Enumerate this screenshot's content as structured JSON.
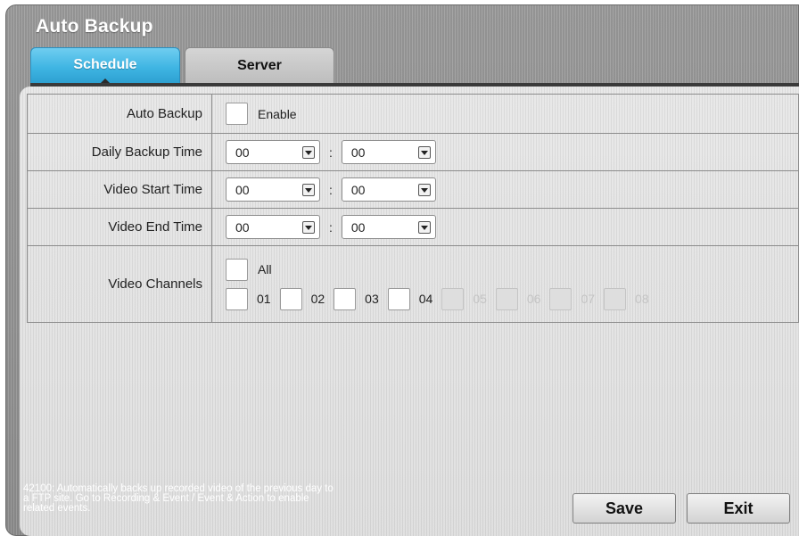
{
  "window": {
    "title": "Auto Backup"
  },
  "tabs": [
    {
      "label": "Schedule",
      "active": true
    },
    {
      "label": "Server",
      "active": false
    }
  ],
  "rows": {
    "auto_backup": {
      "label": "Auto Backup",
      "option": "Enable",
      "checked": false
    },
    "daily_backup_time": {
      "label": "Daily Backup Time",
      "hour": "00",
      "minute": "00"
    },
    "video_start_time": {
      "label": "Video Start Time",
      "hour": "00",
      "minute": "00"
    },
    "video_end_time": {
      "label": "Video End Time",
      "hour": "00",
      "minute": "00"
    },
    "video_channels": {
      "label": "Video Channels",
      "all_label": "All",
      "channels": [
        {
          "label": "01",
          "enabled": true
        },
        {
          "label": "02",
          "enabled": true
        },
        {
          "label": "03",
          "enabled": true
        },
        {
          "label": "04",
          "enabled": true
        },
        {
          "label": "05",
          "enabled": false
        },
        {
          "label": "06",
          "enabled": false
        },
        {
          "label": "07",
          "enabled": false
        },
        {
          "label": "08",
          "enabled": false
        }
      ]
    }
  },
  "time_separator": ":",
  "help_lines": [
    "42100: Automatically backs up recorded video of the previous day to",
    "a FTP site.  Go to Recording & Event / Event & Action to enable",
    "related events."
  ],
  "buttons": {
    "save": "Save",
    "exit": "Exit"
  },
  "colors": {
    "accent": "#3fb5e3",
    "window_bg": "#9b9b9b",
    "panel_bg": "#dedede"
  }
}
